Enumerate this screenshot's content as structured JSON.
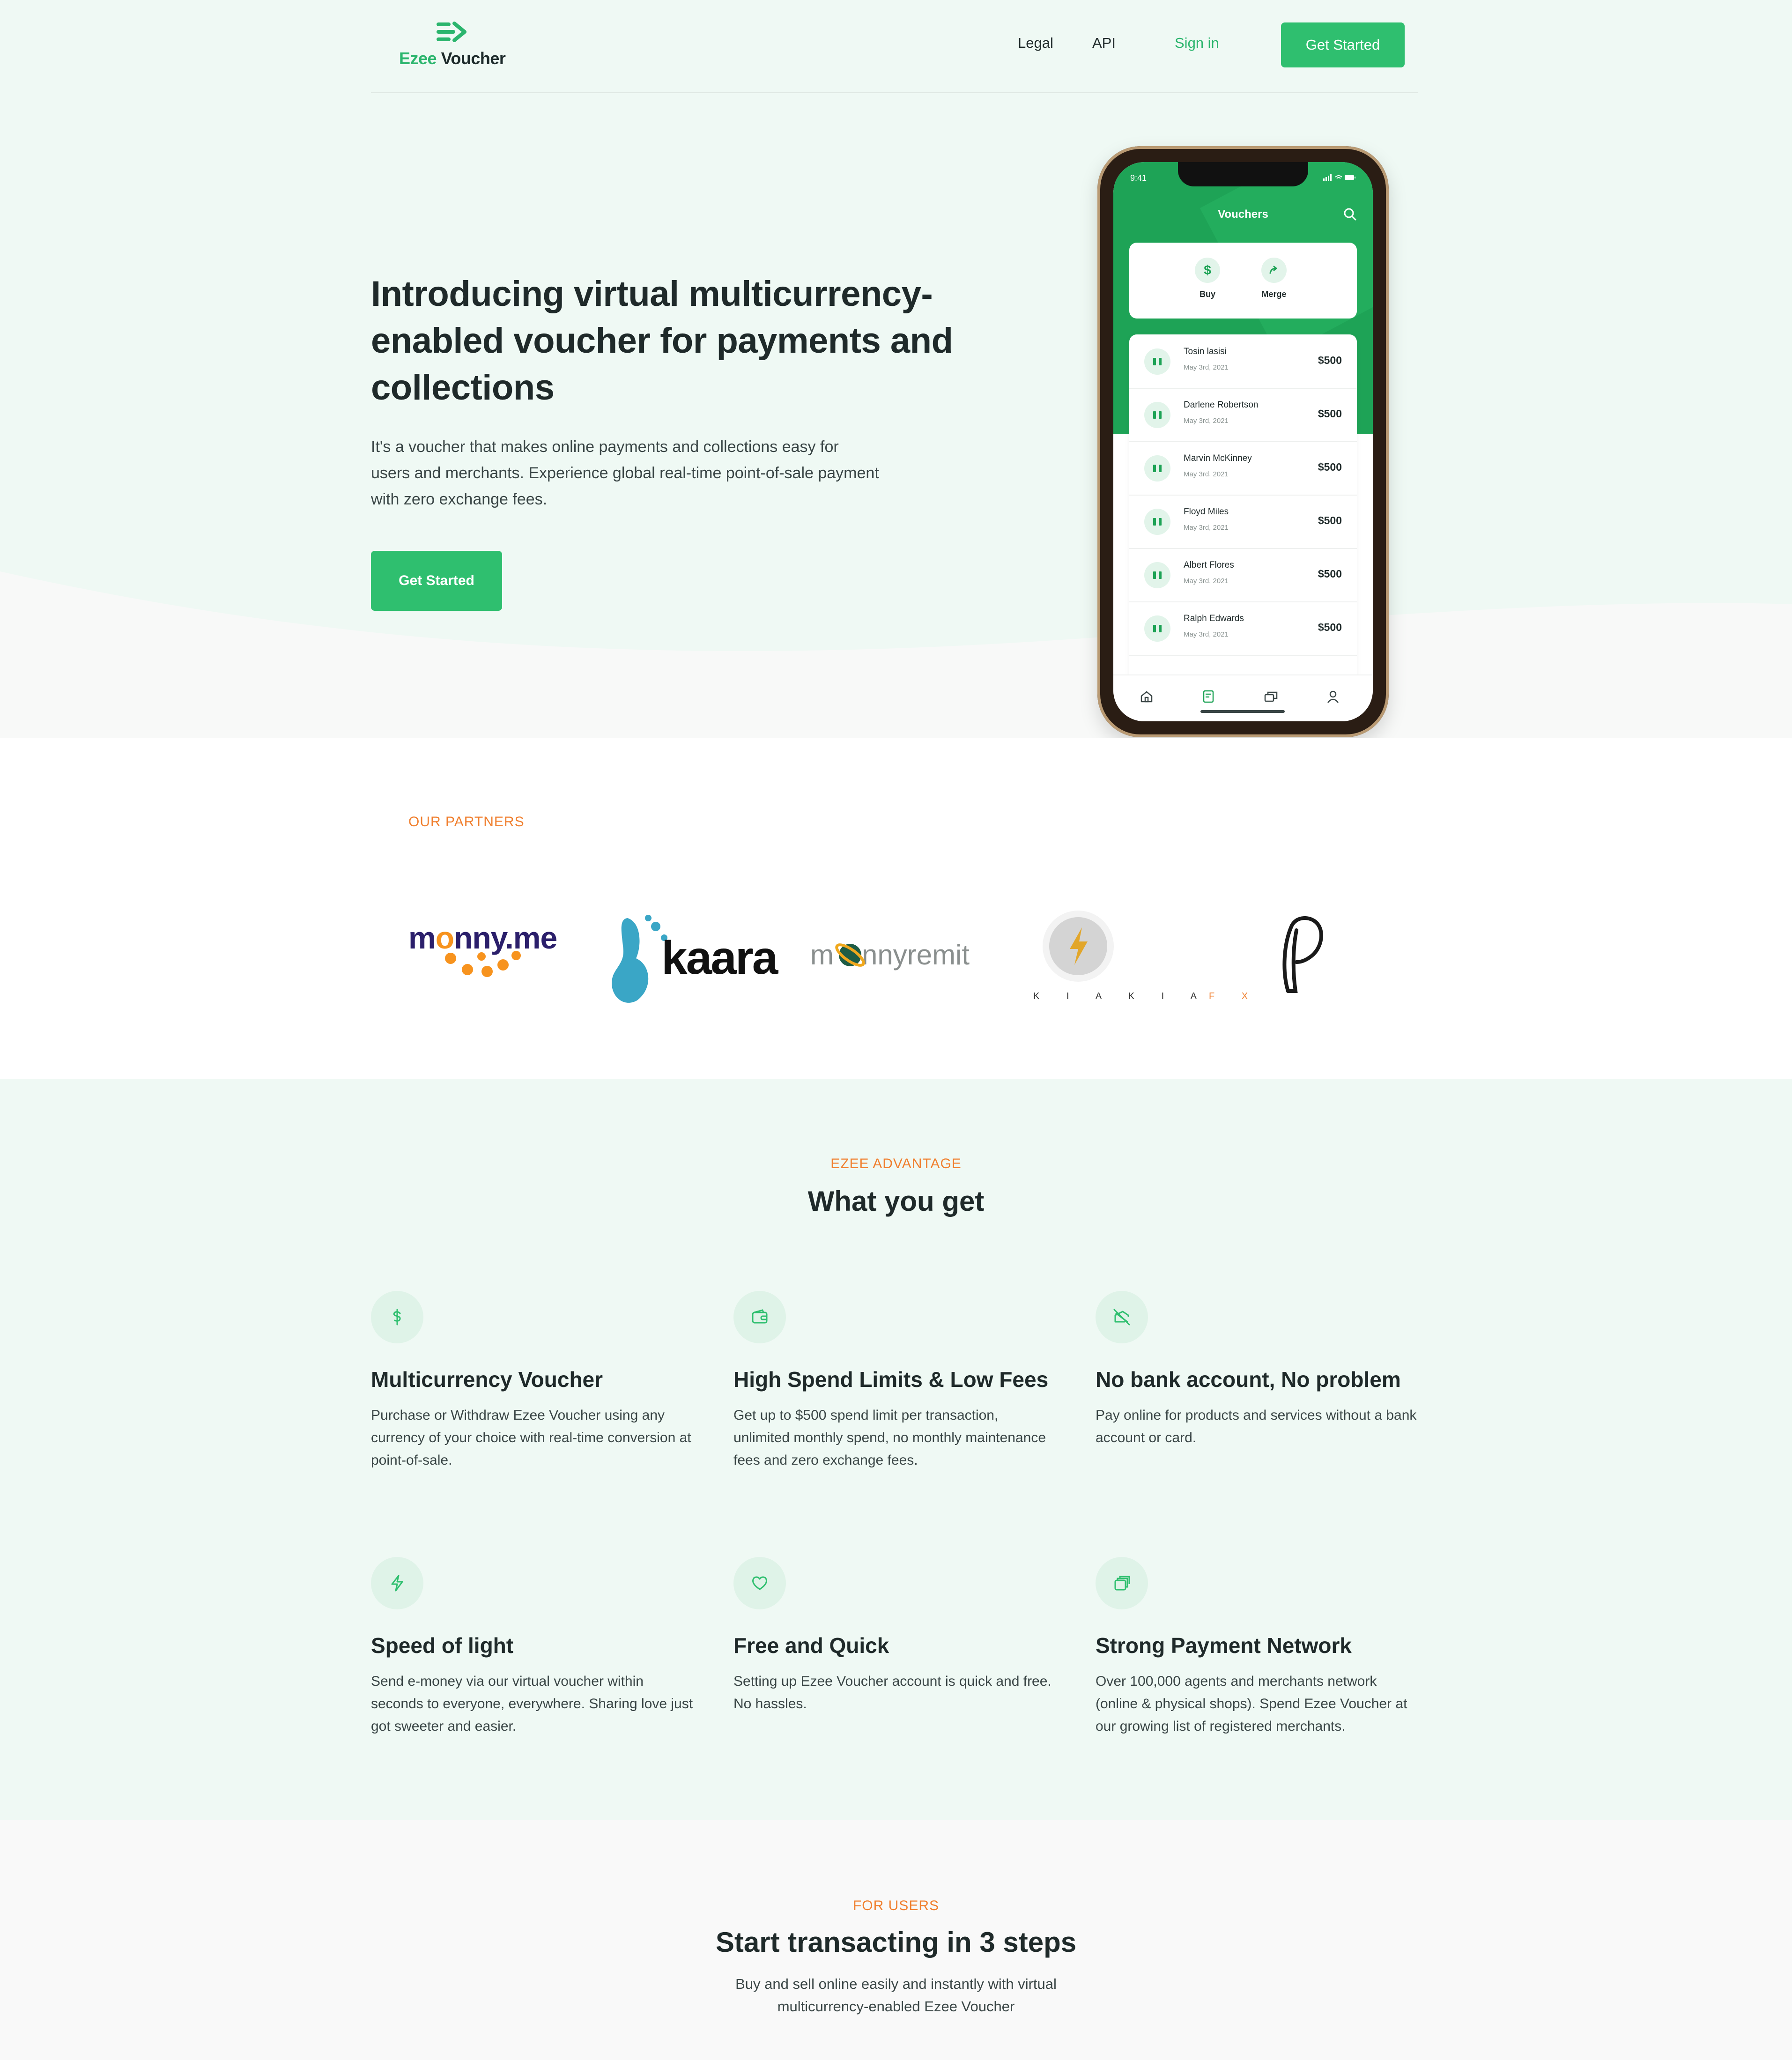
{
  "nav": {
    "logo_part1": "Ezee",
    "logo_part2": "Voucher",
    "links": [
      "Legal",
      "API"
    ],
    "signin": "Sign in",
    "cta": "Get Started"
  },
  "hero": {
    "title": "Introducing virtual multicurrency-enabled voucher for payments and collections",
    "subtitle": "It's a voucher that makes online payments and collections easy for users and merchants. Experience global real-time point-of-sale payment with zero exchange fees.",
    "cta": "Get Started"
  },
  "phone": {
    "time": "9:41",
    "title": "Vouchers",
    "actions": [
      {
        "label": "Buy",
        "icon": "dollar-icon"
      },
      {
        "label": "Merge",
        "icon": "merge-arrow-icon"
      }
    ],
    "vouchers": [
      {
        "name": "Tosin lasisi",
        "date": "May 3rd, 2021",
        "amount": "$500"
      },
      {
        "name": "Darlene Robertson",
        "date": "May 3rd, 2021",
        "amount": "$500"
      },
      {
        "name": "Marvin McKinney",
        "date": "May 3rd, 2021",
        "amount": "$500"
      },
      {
        "name": "Floyd Miles",
        "date": "May 3rd, 2021",
        "amount": "$500"
      },
      {
        "name": "Albert Flores",
        "date": "May 3rd, 2021",
        "amount": "$500"
      },
      {
        "name": "Ralph Edwards",
        "date": "May 3rd, 2021",
        "amount": "$500"
      }
    ],
    "tabs": [
      "home-icon",
      "voucher-icon",
      "cards-icon",
      "profile-icon"
    ]
  },
  "partners": {
    "eyebrow": "OUR PARTNERS",
    "logos": {
      "monny_part1": "m",
      "monny_part2": "nny",
      "monny_part3": ".me",
      "kaara": "kaara",
      "monnyremit_part1": "m",
      "monnyremit_part2": "nnyremit",
      "kiakia_part1": "K I A K I A",
      "kiakia_part2": "F X",
      "p_logo": "P"
    }
  },
  "advantage": {
    "eyebrow": "EZEE ADVANTAGE",
    "title": "What you get",
    "features": [
      {
        "title": "Multicurrency Voucher",
        "text": "Purchase or Withdraw Ezee Voucher using any currency of your choice with real-time conversion at point-of-sale.",
        "icon": "dollar-icon"
      },
      {
        "title": "High Spend Limits & Low Fees",
        "text": "Get up to $500 spend limit per transaction, unlimited monthly spend, no monthly maintenance fees and zero exchange fees.",
        "icon": "wallet-icon"
      },
      {
        "title": "No bank account, No problem",
        "text": "Pay online for products and services without a bank account or card.",
        "icon": "no-card-icon"
      },
      {
        "title": "Speed of light",
        "text": "Send e-money via our virtual voucher within seconds to everyone, everywhere. Sharing love just got sweeter and easier.",
        "icon": "lightning-icon"
      },
      {
        "title": "Free and Quick",
        "text": "Setting up Ezee Voucher account is quick and free. No hassles.",
        "icon": "heart-icon"
      },
      {
        "title": "Strong Payment Network",
        "text": "Over 100,000 agents and merchants network (online & physical shops). Spend Ezee Voucher at our growing list of registered merchants.",
        "icon": "stacked-cards-icon"
      }
    ]
  },
  "steps": {
    "eyebrow": "FOR USERS",
    "title": "Start transacting in 3 steps",
    "subtitle": "Buy and sell online easily and instantly with virtual multicurrency-enabled Ezee Voucher"
  },
  "colors": {
    "brand_green": "#2fbf6f",
    "app_green": "#1ea356",
    "accent_orange": "#f07f2e",
    "hero_bg": "#eff9f4",
    "text_dark": "#1f2a2a"
  }
}
